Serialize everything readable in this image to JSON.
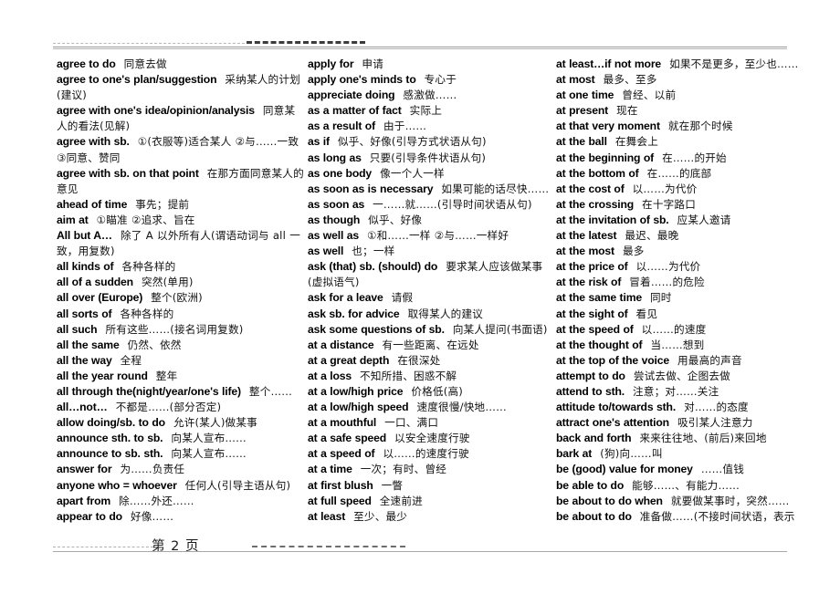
{
  "document": {
    "title": "English Phrases Glossary",
    "page_label": "第 2 页",
    "page_number": 2,
    "header_rule": "dashed-rule",
    "footer_rule": "dashed-rule"
  },
  "columns": [
    {
      "id": "column-1",
      "entries": [
        {
          "en": "agree to do",
          "zh": "同意去做"
        },
        {
          "en": "agree to one's plan/suggestion",
          "zh": "采纳某人的计划(建议)"
        },
        {
          "en": "agree with one's idea/opinion/analysis",
          "zh": "同意某人的看法(见解)"
        },
        {
          "en": "agree with sb.",
          "zh": "①(衣服等)适合某人 ②与……一致 ③同意、赞同"
        },
        {
          "en": "agree with sb. on that point",
          "zh": "在那方面同意某人的意见"
        },
        {
          "en": "ahead of time",
          "zh": "事先；提前"
        },
        {
          "en": "aim at",
          "zh": "①瞄准 ②追求、旨在"
        },
        {
          "en": "All but A…",
          "zh": "除了 A 以外所有人(谓语动词与 all 一致，用复数)"
        },
        {
          "en": "all kinds of",
          "zh": "各种各样的"
        },
        {
          "en": "all of a sudden",
          "zh": "突然(单用)"
        },
        {
          "en": "all over (Europe)",
          "zh": "整个(欧洲)"
        },
        {
          "en": "all sorts of",
          "zh": "各种各样的"
        },
        {
          "en": "all such",
          "zh": "所有这些……(接名词用复数)"
        },
        {
          "en": "all the same",
          "zh": "仍然、依然"
        },
        {
          "en": "all the way",
          "zh": "全程"
        },
        {
          "en": "all the year round",
          "zh": "整年"
        },
        {
          "en": "all through the(night/year/one's life)",
          "zh": "整个……"
        },
        {
          "en": "all…not…",
          "zh": "不都是……(部分否定)"
        },
        {
          "en": "allow doing/sb. to do",
          "zh": "允许(某人)做某事"
        },
        {
          "en": "announce sth. to sb.",
          "zh": "向某人宣布……"
        },
        {
          "en": "announce to sb. sth.",
          "zh": "向某人宣布……"
        },
        {
          "en": "answer for",
          "zh": "为……负责任"
        },
        {
          "en": "anyone who = whoever",
          "zh": "任何人(引导主语从句)"
        },
        {
          "en": "apart from",
          "zh": "除……外还……"
        },
        {
          "en": "appear to do",
          "zh": "好像……"
        }
      ]
    },
    {
      "id": "column-2",
      "entries": [
        {
          "en": "apply for",
          "zh": "申请"
        },
        {
          "en": "apply one's minds to",
          "zh": "专心于"
        },
        {
          "en": "appreciate doing",
          "zh": "感激做……"
        },
        {
          "en": "as a matter of fact",
          "zh": "实际上"
        },
        {
          "en": "as a result of",
          "zh": "由于……"
        },
        {
          "en": "as if",
          "zh": "似乎、好像(引导方式状语从句)"
        },
        {
          "en": "as long as",
          "zh": "只要(引导条件状语从句)"
        },
        {
          "en": "as one body",
          "zh": "像一个人一样"
        },
        {
          "en": "as soon as is necessary",
          "zh": "如果可能的话尽快……"
        },
        {
          "en": "as soon as",
          "zh": "一……就……(引导时间状语从句)"
        },
        {
          "en": "as though",
          "zh": "似乎、好像"
        },
        {
          "en": "as well as",
          "zh": "①和……一样 ②与……一样好"
        },
        {
          "en": "as well",
          "zh": "也；一样"
        },
        {
          "en": "ask (that) sb. (should) do",
          "zh": "要求某人应该做某事(虚拟语气)"
        },
        {
          "en": "ask for a leave",
          "zh": "请假"
        },
        {
          "en": "ask sb. for advice",
          "zh": "取得某人的建议"
        },
        {
          "en": "ask some questions of sb.",
          "zh": "向某人提问(书面语)"
        },
        {
          "en": "at a distance",
          "zh": "有一些距离、在远处"
        },
        {
          "en": "at a great depth",
          "zh": "在很深处"
        },
        {
          "en": "at a loss",
          "zh": "不知所措、困惑不解"
        },
        {
          "en": "at a low/high price",
          "zh": "价格低(高)"
        },
        {
          "en": "at a low/high speed",
          "zh": "速度很慢/快地……"
        },
        {
          "en": "at a mouthful",
          "zh": "一口、满口"
        },
        {
          "en": "at a safe speed",
          "zh": "以安全速度行驶"
        },
        {
          "en": "at a speed of",
          "zh": "以……的速度行驶"
        },
        {
          "en": "at a time",
          "zh": "一次；有时、曾经"
        },
        {
          "en": "at first blush",
          "zh": "一瞥"
        },
        {
          "en": "at full speed",
          "zh": "全速前进"
        },
        {
          "en": "at least",
          "zh": "至少、最少"
        }
      ]
    },
    {
      "id": "column-3",
      "entries": [
        {
          "en": "at least…if not more",
          "zh": "如果不是更多，至少也……"
        },
        {
          "en": "at most",
          "zh": "最多、至多"
        },
        {
          "en": "at one time",
          "zh": "曾经、以前"
        },
        {
          "en": "at present",
          "zh": "现在"
        },
        {
          "en": "at that very moment",
          "zh": "就在那个时候"
        },
        {
          "en": "at the ball",
          "zh": "在舞会上"
        },
        {
          "en": "at the beginning of",
          "zh": "在……的开始"
        },
        {
          "en": "at the bottom of",
          "zh": "在……的底部"
        },
        {
          "en": "at the cost of",
          "zh": "以……为代价"
        },
        {
          "en": "at the crossing",
          "zh": "在十字路口"
        },
        {
          "en": "at the invitation of sb.",
          "zh": "应某人邀请"
        },
        {
          "en": "at the latest",
          "zh": "最迟、最晚"
        },
        {
          "en": "at the most",
          "zh": "最多"
        },
        {
          "en": "at the price of",
          "zh": "以……为代价"
        },
        {
          "en": "at the risk of",
          "zh": "冒着……的危险"
        },
        {
          "en": "at the same time",
          "zh": "同时"
        },
        {
          "en": "at the sight of",
          "zh": "看见"
        },
        {
          "en": "at the speed of",
          "zh": "以……的速度"
        },
        {
          "en": "at the thought of",
          "zh": "当……想到"
        },
        {
          "en": "at the top of the voice",
          "zh": "用最高的声音"
        },
        {
          "en": "attempt to do",
          "zh": "尝试去做、企图去做"
        },
        {
          "en": "attend to sth.",
          "zh": "注意；对……关注"
        },
        {
          "en": "attitude to/towards sth.",
          "zh": "对……的态度"
        },
        {
          "en": "attract one's attention",
          "zh": "吸引某人注意力"
        },
        {
          "en": "back and forth",
          "zh": "来来往往地、(前后)来回地"
        },
        {
          "en": "bark at",
          "zh": "(狗)向……叫"
        },
        {
          "en": "be (good) value for money",
          "zh": "……值钱"
        },
        {
          "en": "be able to do",
          "zh": "能够……、有能力……"
        },
        {
          "en": "be about to do when",
          "zh": "就要做某事时，突然……"
        },
        {
          "en": "be about to do",
          "zh": "准备做……(不接时间状语，表示"
        }
      ]
    }
  ]
}
